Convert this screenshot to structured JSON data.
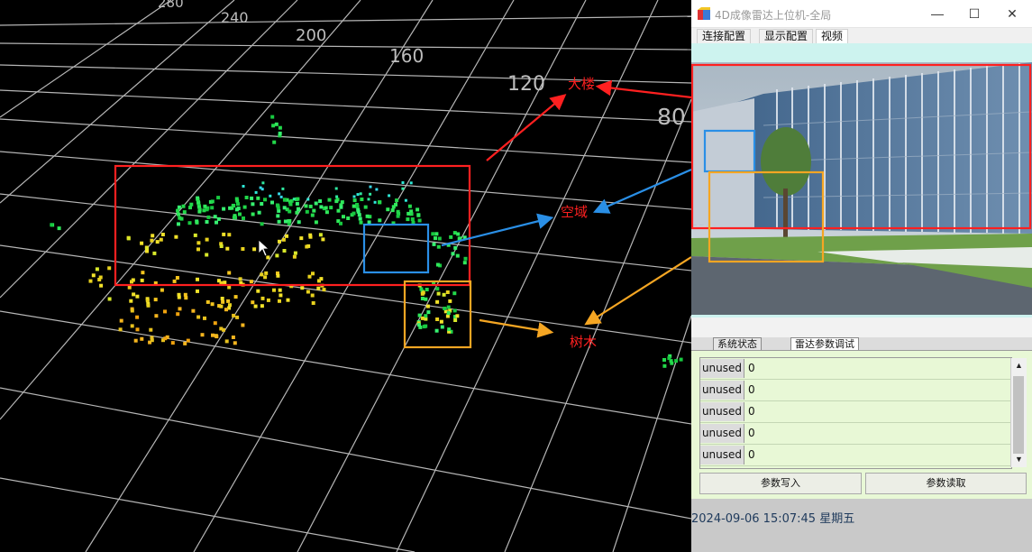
{
  "viz": {
    "axis_ticks": [
      "280",
      "240",
      "200",
      "160",
      "120",
      "80"
    ],
    "annotations": {
      "building": "大楼",
      "open_space": "空域",
      "tree": "树木"
    },
    "colors": {
      "grid": "#d9d9d9",
      "building_box": "#ff2020",
      "open_box": "#2a8fe6",
      "tree_box": "#f5a623"
    }
  },
  "window": {
    "title": "4D成像雷达上位机-全局",
    "controls": {
      "minimize": "—",
      "maximize": "☐",
      "close": "✕"
    },
    "tabs": [
      "连接配置",
      "显示配置",
      "视频"
    ],
    "active_tab": "视频",
    "sub_tabs": [
      "系统状态",
      "雷达参数调试"
    ],
    "active_sub_tab": "雷达参数调试",
    "param_rows": [
      {
        "name": "unused",
        "value": "0"
      },
      {
        "name": "unused",
        "value": "0"
      },
      {
        "name": "unused",
        "value": "0"
      },
      {
        "name": "unused",
        "value": "0"
      },
      {
        "name": "unused",
        "value": "0"
      }
    ],
    "scroll": {
      "up": "▲",
      "down": "▼"
    },
    "buttons": {
      "write": "参数写入",
      "read": "参数读取"
    },
    "clock": "2024-09-06 15:07:45 星期五"
  }
}
